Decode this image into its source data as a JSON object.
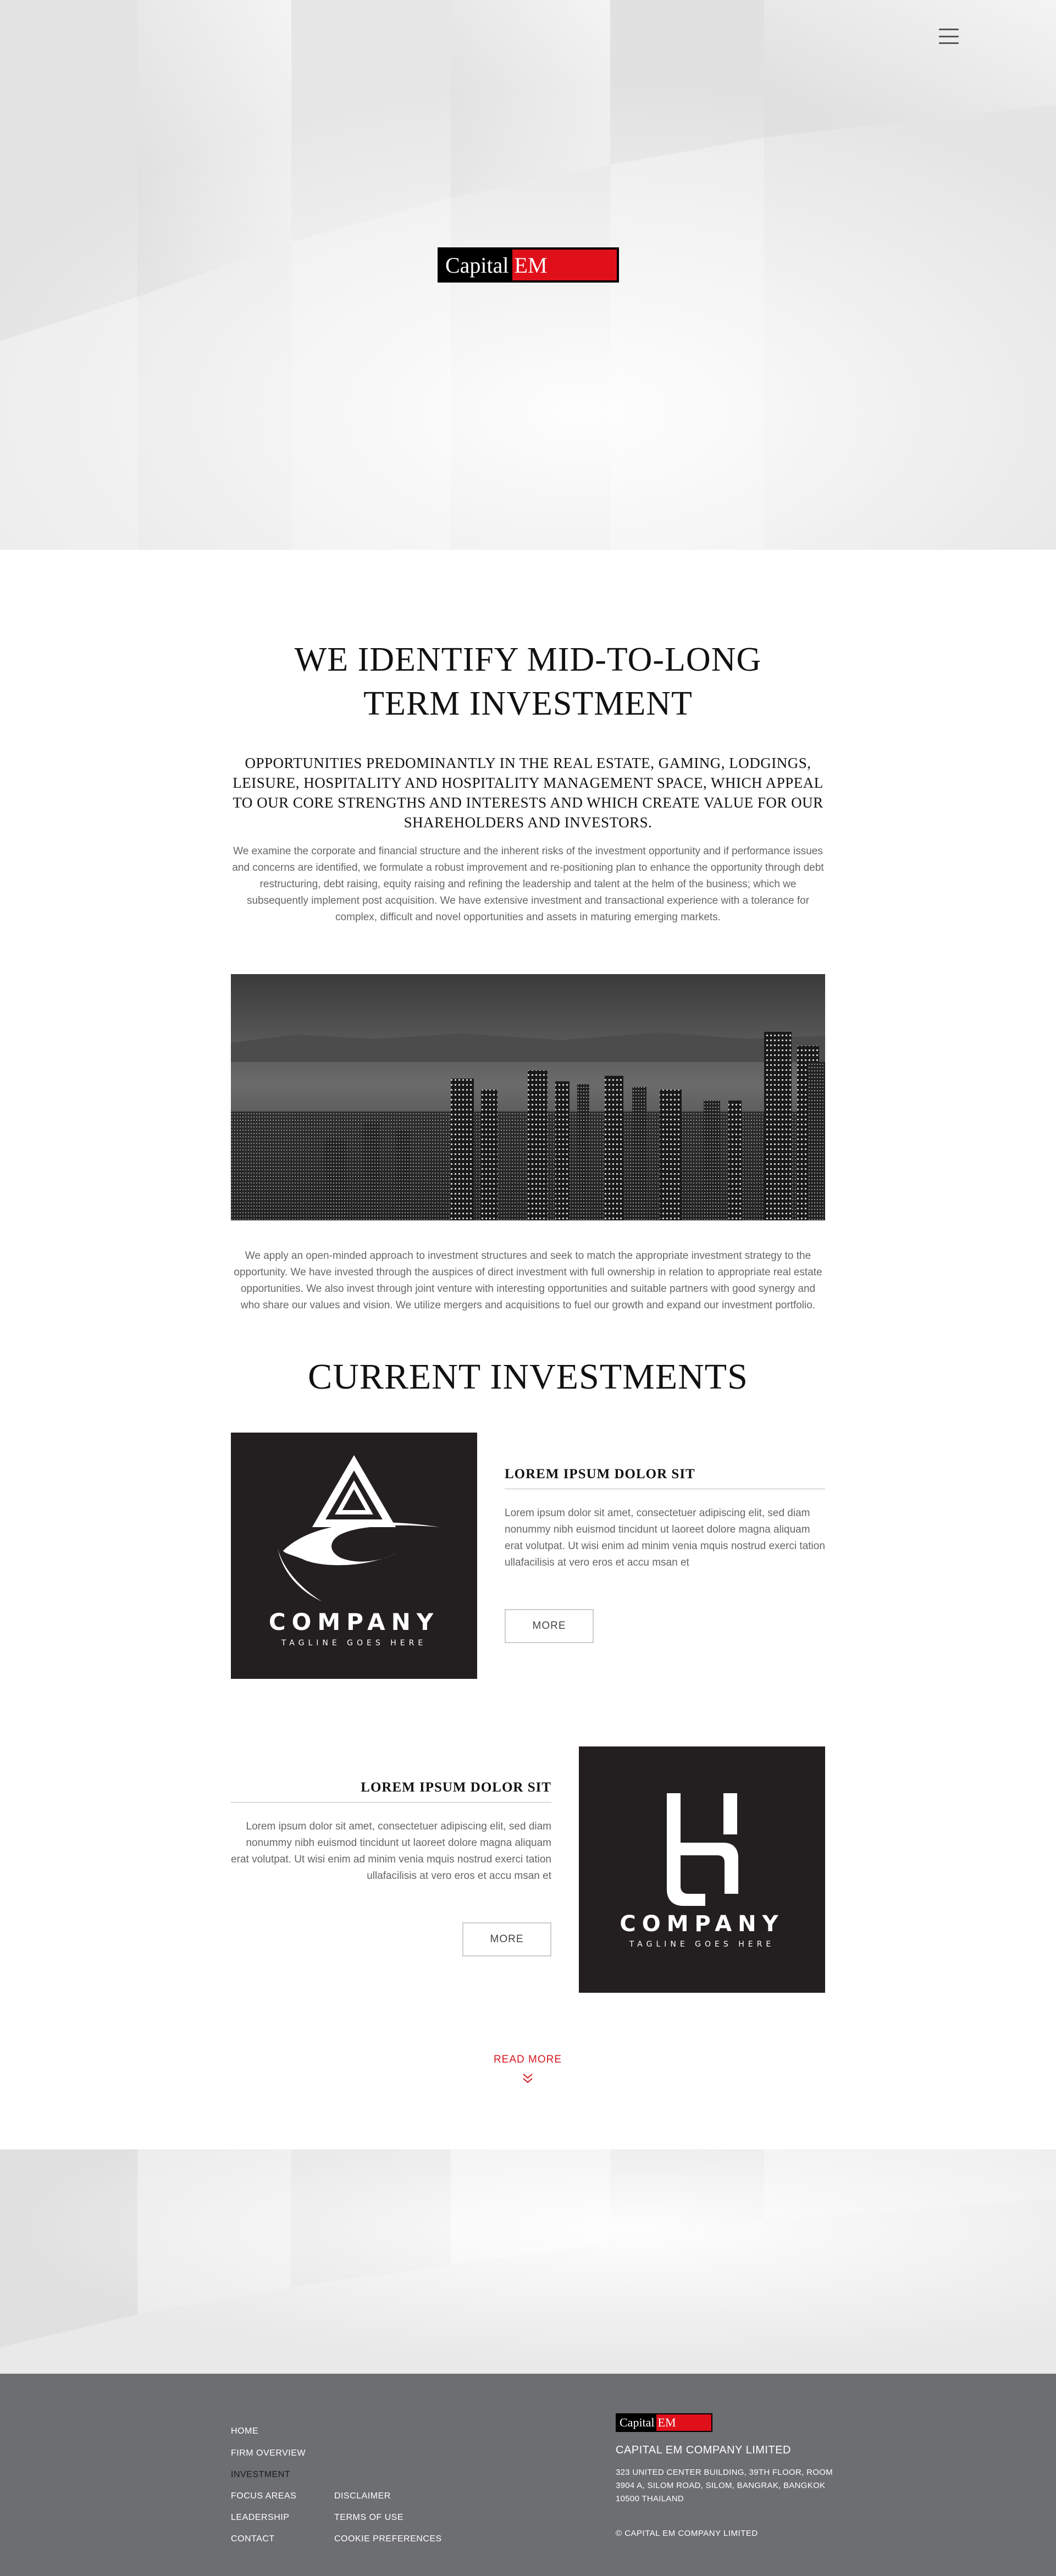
{
  "brand": {
    "logo_left": "Capital",
    "logo_right": "EM",
    "red": "#e0101b"
  },
  "header": {
    "menu_icon": "hamburger-icon"
  },
  "intro": {
    "heading_line1": "WE IDENTIFY MID-TO-LONG",
    "heading_line2": "TERM INVESTMENT",
    "subheading": "OPPORTUNITIES PREDOMINANTLY IN THE REAL ESTATE, GAMING, LODGINGS, LEISURE, HOSPITALITY AND HOSPITALITY MANAGEMENT SPACE, WHICH APPEAL TO OUR CORE STRENGTHS AND INTERESTS AND WHICH CREATE VALUE FOR OUR SHAREHOLDERS AND INVESTORS.",
    "paragraph1": "We examine the corporate and financial structure and the inherent risks of the investment opportunity and if performance issues and concerns are identified, we formulate a robust improvement and re-positioning plan to enhance the opportunity through debt restructuring, debt raising, equity raising and refining the leadership and talent at the helm of the business; which we subsequently implement post acquisition. We have extensive investment and transactional experience with a tolerance for complex, difficult and novel opportunities and assets in maturing emerging markets.",
    "paragraph2": "We apply an open-minded approach to investment structures and seek to match the appropriate investment strategy to the opportunity. We have invested through the auspices of direct investment with full ownership in relation to appropriate real estate opportunities. We also invest through joint venture with interesting opportunities and suitable partners with good synergy and who share our values and vision. We utilize mergers and acquisitions to fuel our growth and expand our investment portfolio."
  },
  "investments": {
    "heading": "CURRENT INVESTMENTS",
    "items": [
      {
        "logo_name": "COMPANY",
        "logo_tagline": "TAGLINE GOES HERE",
        "title": "LOREM IPSUM DOLOR SIT",
        "text": "Lorem ipsum dolor sit amet, consectetuer adipiscing elit, sed diam nonummy nibh euismod tincidunt ut laoreet dolore magna aliquam erat volutpat. Ut wisi enim ad minim venia mquis nostrud exerci tation ullafacilisis at vero eros et accu msan et",
        "button": "MORE"
      },
      {
        "logo_name": "COMPANY",
        "logo_tagline": "TAGLINE GOES HERE",
        "title": "LOREM IPSUM DOLOR SIT",
        "text": "Lorem ipsum dolor sit amet, consectetuer adipiscing elit, sed diam nonummy nibh euismod tincidunt ut laoreet dolore magna aliquam erat volutpat. Ut wisi enim ad minim venia mquis nostrud exerci tation ullafacilisis at vero eros et accu msan et",
        "button": "MORE"
      }
    ],
    "read_more": "READ MORE"
  },
  "footer": {
    "nav_col1": [
      "HOME",
      "FIRM OVERVIEW",
      "INVESTMENT",
      "FOCUS AREAS",
      "LEADERSHIP",
      "CONTACT"
    ],
    "nav_col2": [
      "DISCLAIMER",
      "TERMS OF USE",
      "COOKIE PREFERENCES"
    ],
    "company_name": "CAPITAL EM COMPANY LIMITED",
    "address": "323 UNITED CENTER BUILDING, 39TH FLOOR, ROOM 3904 A, SILOM ROAD, SILOM, BANGRAK, BANGKOK 10500 THAILAND",
    "copyright": "© CAPITAL EM COMPANY LIMITED",
    "background": "#6d6e71",
    "active_color": "#1a1a1a"
  }
}
